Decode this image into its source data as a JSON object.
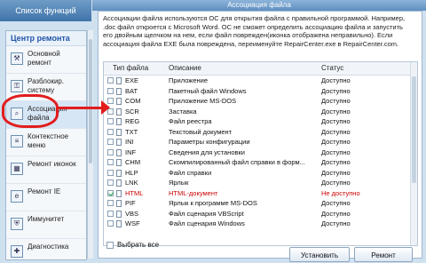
{
  "left_panel": {
    "title": "Список функций",
    "header": "Центр ремонта",
    "items": [
      {
        "label": "Основной ремонт",
        "icon": "wrench-icon"
      },
      {
        "label": "Разблокир. систему",
        "icon": "unlock-icon"
      },
      {
        "label": "Ассоциация файла",
        "icon": "magnifier-icon"
      },
      {
        "label": "Контекстное меню",
        "icon": "menu-icon"
      },
      {
        "label": "Ремонт иконок",
        "icon": "icons-icon"
      },
      {
        "label": "Ремонт IE",
        "icon": "ie-icon"
      },
      {
        "label": "Иммунитет",
        "icon": "shield-icon"
      },
      {
        "label": "Диагностика",
        "icon": "diagnostics-icon"
      }
    ]
  },
  "main_panel": {
    "title": "Ассоциация файла",
    "description_lines": [
      "Ассоциации файла используются ОС для открытия файла с правильной программой. Например,",
      ".doc файл откроется с Microsoft Word. ОС не сможет определить ассоциацию файла и запустить",
      "его двойным щелчком на нем, если файл поврежден(иконка отображена неправильно). Если",
      "ассоциация файла EXE была повреждена, переименуйте RepairCenter.exe в RepairCenter.com."
    ],
    "columns": {
      "type": "Тип файла",
      "description": "Описание",
      "status": "Статус"
    },
    "rows": [
      {
        "type": "EXE",
        "description": "Приложение",
        "status": "Доступно",
        "checked": false
      },
      {
        "type": "BAT",
        "description": "Пакетный файл Windows",
        "status": "Доступно",
        "checked": false
      },
      {
        "type": "COM",
        "description": "Приложение MS-DOS",
        "status": "Доступно",
        "checked": false
      },
      {
        "type": "SCR",
        "description": "Заставка",
        "status": "Доступно",
        "checked": false
      },
      {
        "type": "REG",
        "description": "Файл реестра",
        "status": "Доступно",
        "checked": false
      },
      {
        "type": "TXT",
        "description": "Текстовый документ",
        "status": "Доступно",
        "checked": false
      },
      {
        "type": "INI",
        "description": "Параметры конфигурации",
        "status": "Доступно",
        "checked": false
      },
      {
        "type": "INF",
        "description": "Сведения для установки",
        "status": "Доступно",
        "checked": false
      },
      {
        "type": "CHM",
        "description": "Скомпилированный файл справки в форм...",
        "status": "Доступно",
        "checked": false
      },
      {
        "type": "HLP",
        "description": "Файл справки",
        "status": "Доступно",
        "checked": false
      },
      {
        "type": "LNK",
        "description": "Ярлык",
        "status": "Доступно",
        "checked": false
      },
      {
        "type": "HTML",
        "description": "HTML-документ",
        "status": "Не доступно",
        "checked": true
      },
      {
        "type": "PIF",
        "description": "Ярлык к программе MS-DOS",
        "status": "Доступно",
        "checked": false
      },
      {
        "type": "VBS",
        "description": "Файл сценария VBScript",
        "status": "Доступно",
        "checked": false
      },
      {
        "type": "WSF",
        "description": "Файл сценария Windows",
        "status": "Доступно",
        "checked": false
      }
    ],
    "select_all_label": "Выбрать все",
    "install_button": "Установить",
    "repair_button": "Ремонт"
  },
  "colors": {
    "accent": "#3f73a9",
    "unavailable": "#cc0000",
    "annotation": "#e21d1d"
  }
}
